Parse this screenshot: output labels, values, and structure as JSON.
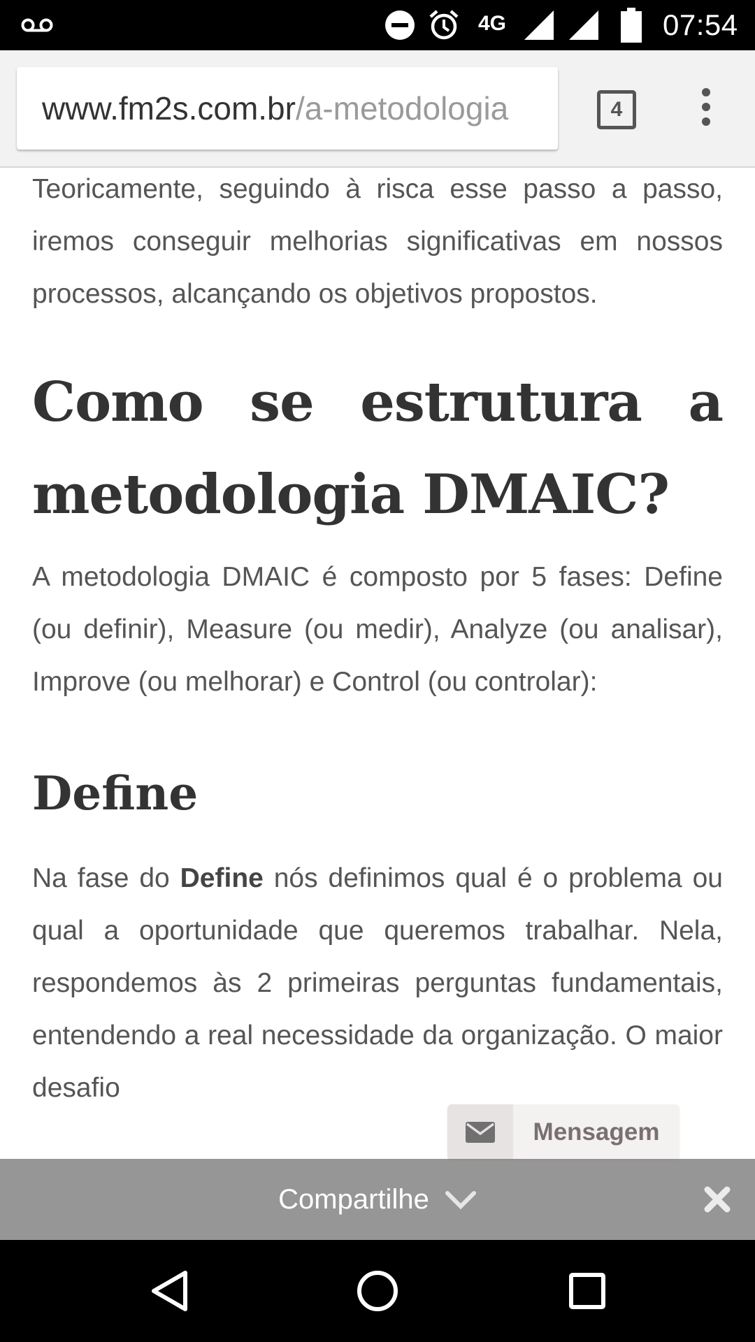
{
  "status_bar": {
    "network_label": "4G",
    "time": "07:54",
    "icons": [
      "voicemail-icon",
      "do-not-disturb-icon",
      "alarm-icon",
      "signal-icon",
      "signal-icon",
      "battery-icon"
    ]
  },
  "browser": {
    "url_host": "www.fm2s.com.br",
    "url_path": "/a-metodologia",
    "tab_count": "4"
  },
  "article": {
    "intro_paragraph": "Teoricamente, seguindo à risca esse passo a passo, iremos conseguir melhorias significativas em nossos processos, alcançando os objetivos propostos.",
    "main_heading": "Como se estrutura a metodologia DMAIC?",
    "phases_paragraph": "A metodologia DMAIC é composto por 5 fases: Define (ou definir), Measure (ou medir), Analyze (ou analisar), Improve (ou melhorar) e Control (ou controlar):",
    "define_heading": "Define",
    "define_paragraph": {
      "prefix": "Na fase do ",
      "bold": "Define",
      "suffix": " nós definimos qual é o problema ou qual a oportunidade que queremos trabalhar. Nela, respondemos às 2 primeiras perguntas fundamentais, entendendo a real necessidade da organização. O maior desafio"
    }
  },
  "message_widget": {
    "label": "Mensagem",
    "icon": "envelope-icon"
  },
  "share_bar": {
    "label": "Compartilhe",
    "icons": [
      "chevron-down-icon",
      "close-icon"
    ]
  },
  "nav_bar": {
    "icons": [
      "back-icon",
      "home-icon",
      "recents-icon"
    ]
  },
  "colors": {
    "body_text": "#555555",
    "heading_text": "#333333",
    "url_host": "#333333",
    "url_path": "#9a9a9a",
    "share_bar_bg": "#787878"
  }
}
